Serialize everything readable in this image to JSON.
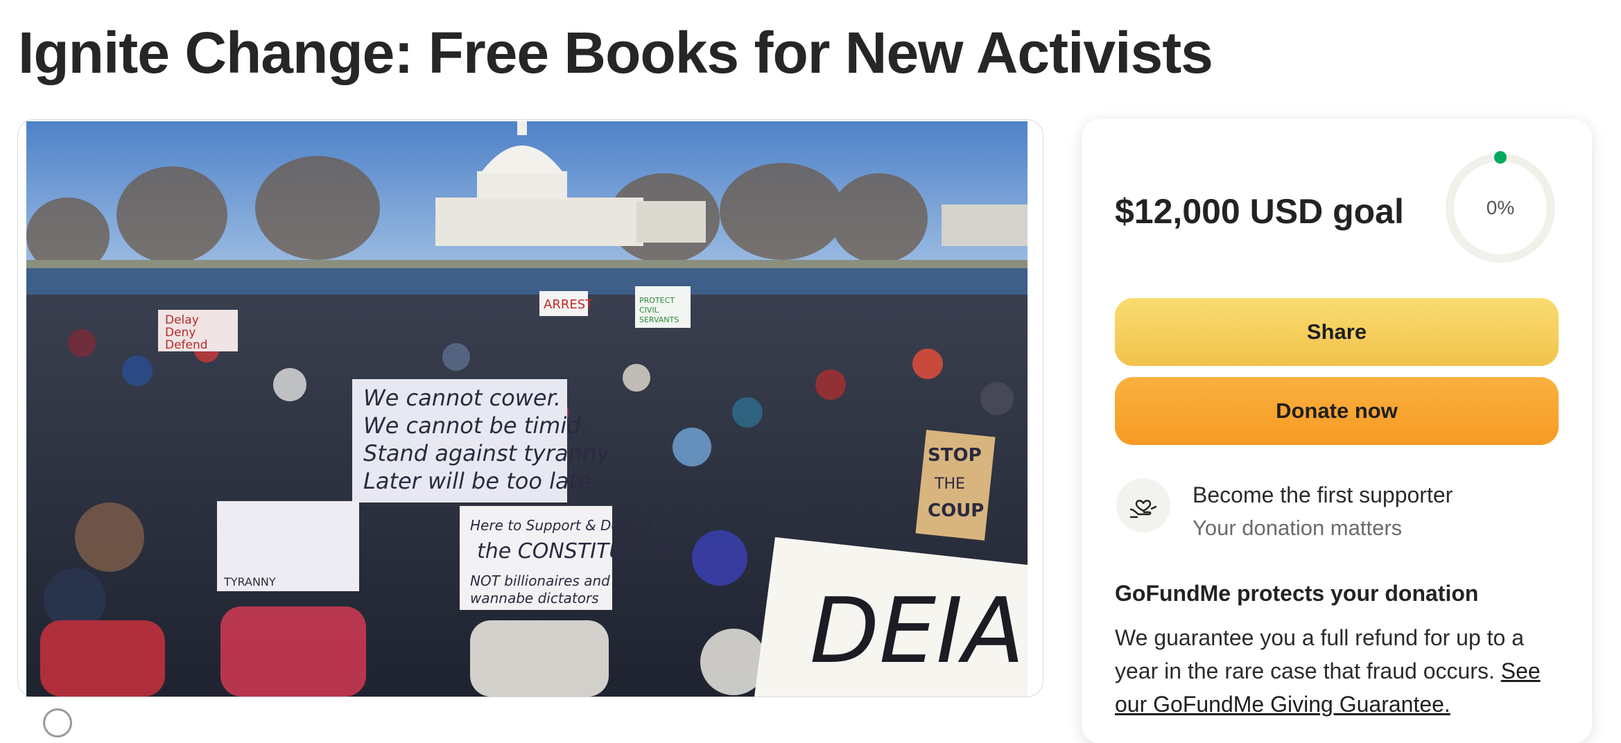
{
  "page": {
    "title": "Ignite Change: Free Books for New Activists"
  },
  "photo": {
    "alt": "Crowd of protesters holding signs in front of the U.S. Capitol",
    "signs": [
      "We cannot cower.",
      "We cannot be timid.",
      "Stand against tyranny.",
      "Later will be too late",
      "Here to Support & Defend",
      "the CONSTITUTION",
      "NOT billionaires and wannabe dictators",
      "STOP THE COUP",
      "Delay Deny Defend",
      "ARREST",
      "PROTECT CIVIL SERVANTS",
      "DEIA"
    ]
  },
  "donation": {
    "goal_text": "$12,000 USD goal",
    "progress_label": "0%",
    "progress_fraction": 0,
    "share_label": "Share",
    "donate_label": "Donate now",
    "supporter_title": "Become the first supporter",
    "supporter_subtitle": "Your donation matters",
    "protect_heading": "GoFundMe protects your donation",
    "protect_text": "We guarantee you a full refund for up to a year in the rare case that fraud occurs. ",
    "protect_link": "See our GoFundMe Giving Guarantee."
  },
  "colors": {
    "share_button": "#f5cd5a",
    "donate_button": "#f8a632",
    "progress_dot": "#02a95c",
    "ring_track": "#f1f0ea"
  },
  "icons": {
    "supporter": "heart-hand-icon",
    "progress": "progress-ring"
  }
}
